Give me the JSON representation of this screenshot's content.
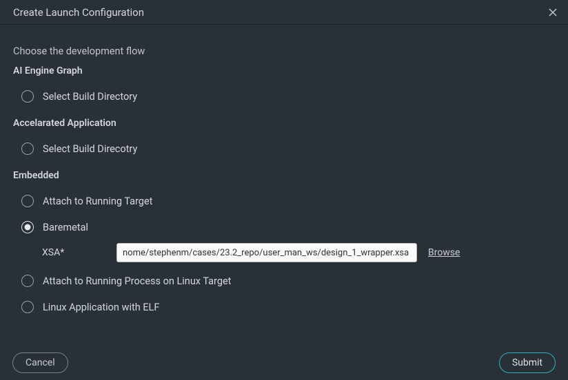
{
  "title": "Create Launch Configuration",
  "prompt": "Choose the development flow",
  "sections": {
    "aiEngine": {
      "header": "AI Engine Graph",
      "option0": {
        "label": "Select Build Directory",
        "selected": false
      }
    },
    "accelApp": {
      "header": "Accelarated Application",
      "option0": {
        "label": "Select Build Direcotry",
        "selected": false
      }
    },
    "embedded": {
      "header": "Embedded",
      "option0": {
        "label": "Attach to Running Target",
        "selected": false
      },
      "option1": {
        "label": "Baremetal",
        "selected": true
      },
      "option2": {
        "label": "Attach to Running Process on Linux Target",
        "selected": false
      },
      "option3": {
        "label": "Linux Application with ELF",
        "selected": false
      }
    }
  },
  "xsa": {
    "label": "XSA*",
    "value": "nome/stephenm/cases/23.2_repo/user_man_ws/design_1_wrapper.xsa",
    "browse": "Browse"
  },
  "buttons": {
    "cancel": "Cancel",
    "submit": "Submit"
  }
}
